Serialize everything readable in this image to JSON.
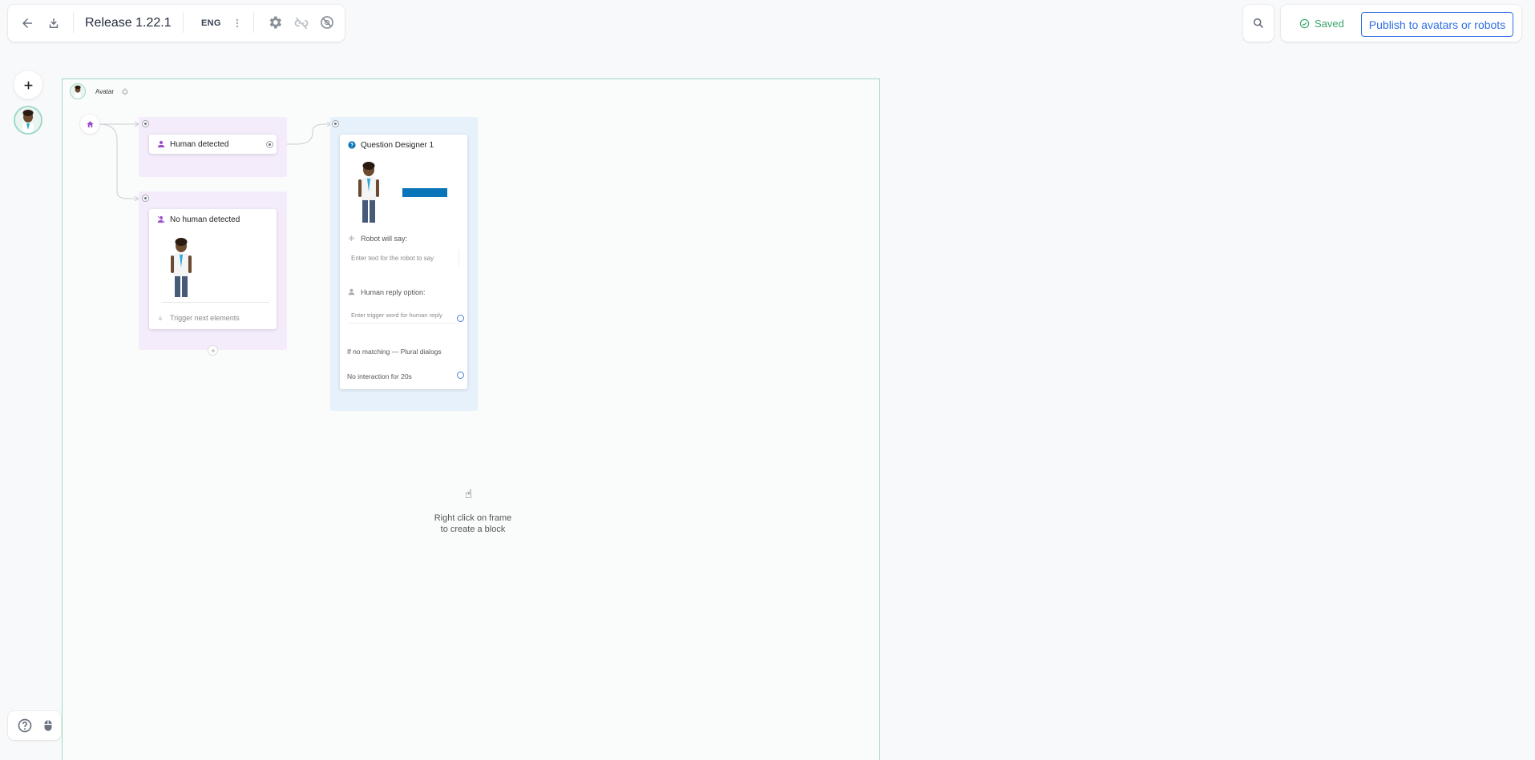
{
  "toolbar": {
    "back_icon": "arrow-left-icon",
    "download_icon": "download-icon",
    "project_title": "Release 1.22.1",
    "language": "ENG",
    "more_icon": "kebab-menu-icon",
    "settings_icon": "gear-icon",
    "unlink_icon": "link-off-icon",
    "disabled_icon": "no-entry-icon",
    "search_icon": "search-icon",
    "saved_label": "Saved",
    "publish_label": "Publish to avatars or robots"
  },
  "left_rail": {
    "add_icon": "plus-icon"
  },
  "frame": {
    "name": "Avatar",
    "settings_icon": "gear-icon",
    "home_icon": "home-icon"
  },
  "blocks": {
    "human_detected": {
      "label": "Human detected",
      "icon": "person-icon"
    },
    "no_human_detected": {
      "label": "No human detected",
      "icon": "person-off-icon",
      "trigger_label": "Trigger next elements"
    },
    "question_designer": {
      "label": "Question Designer 1",
      "icon": "question-circle-icon",
      "robot_say_label": "Robot will say:",
      "robot_say_placeholder": "Enter text for the robot to say",
      "human_reply_label": "Human reply option:",
      "human_reply_placeholder": "Enter trigger word for human reply",
      "no_match_label": "If no matching — Plural dialogs",
      "no_interaction_label": "No interaction for 20s"
    }
  },
  "canvas_hint": {
    "icon": "pointing-hand-icon",
    "line1": "Right click on frame",
    "line2": "to create a block"
  },
  "bottom_left": {
    "help_icon": "help-circle-icon",
    "mouse_icon": "mouse-icon"
  },
  "colors": {
    "accent_blue": "#2f6fe5",
    "saved_green": "#3aa56b",
    "frame_border": "#9fd9c5",
    "purple_group": "#f5ecfb",
    "blue_group": "#e6f1fb",
    "purple_icon": "#9c4dcc",
    "blue_bar": "#0a74b8"
  }
}
